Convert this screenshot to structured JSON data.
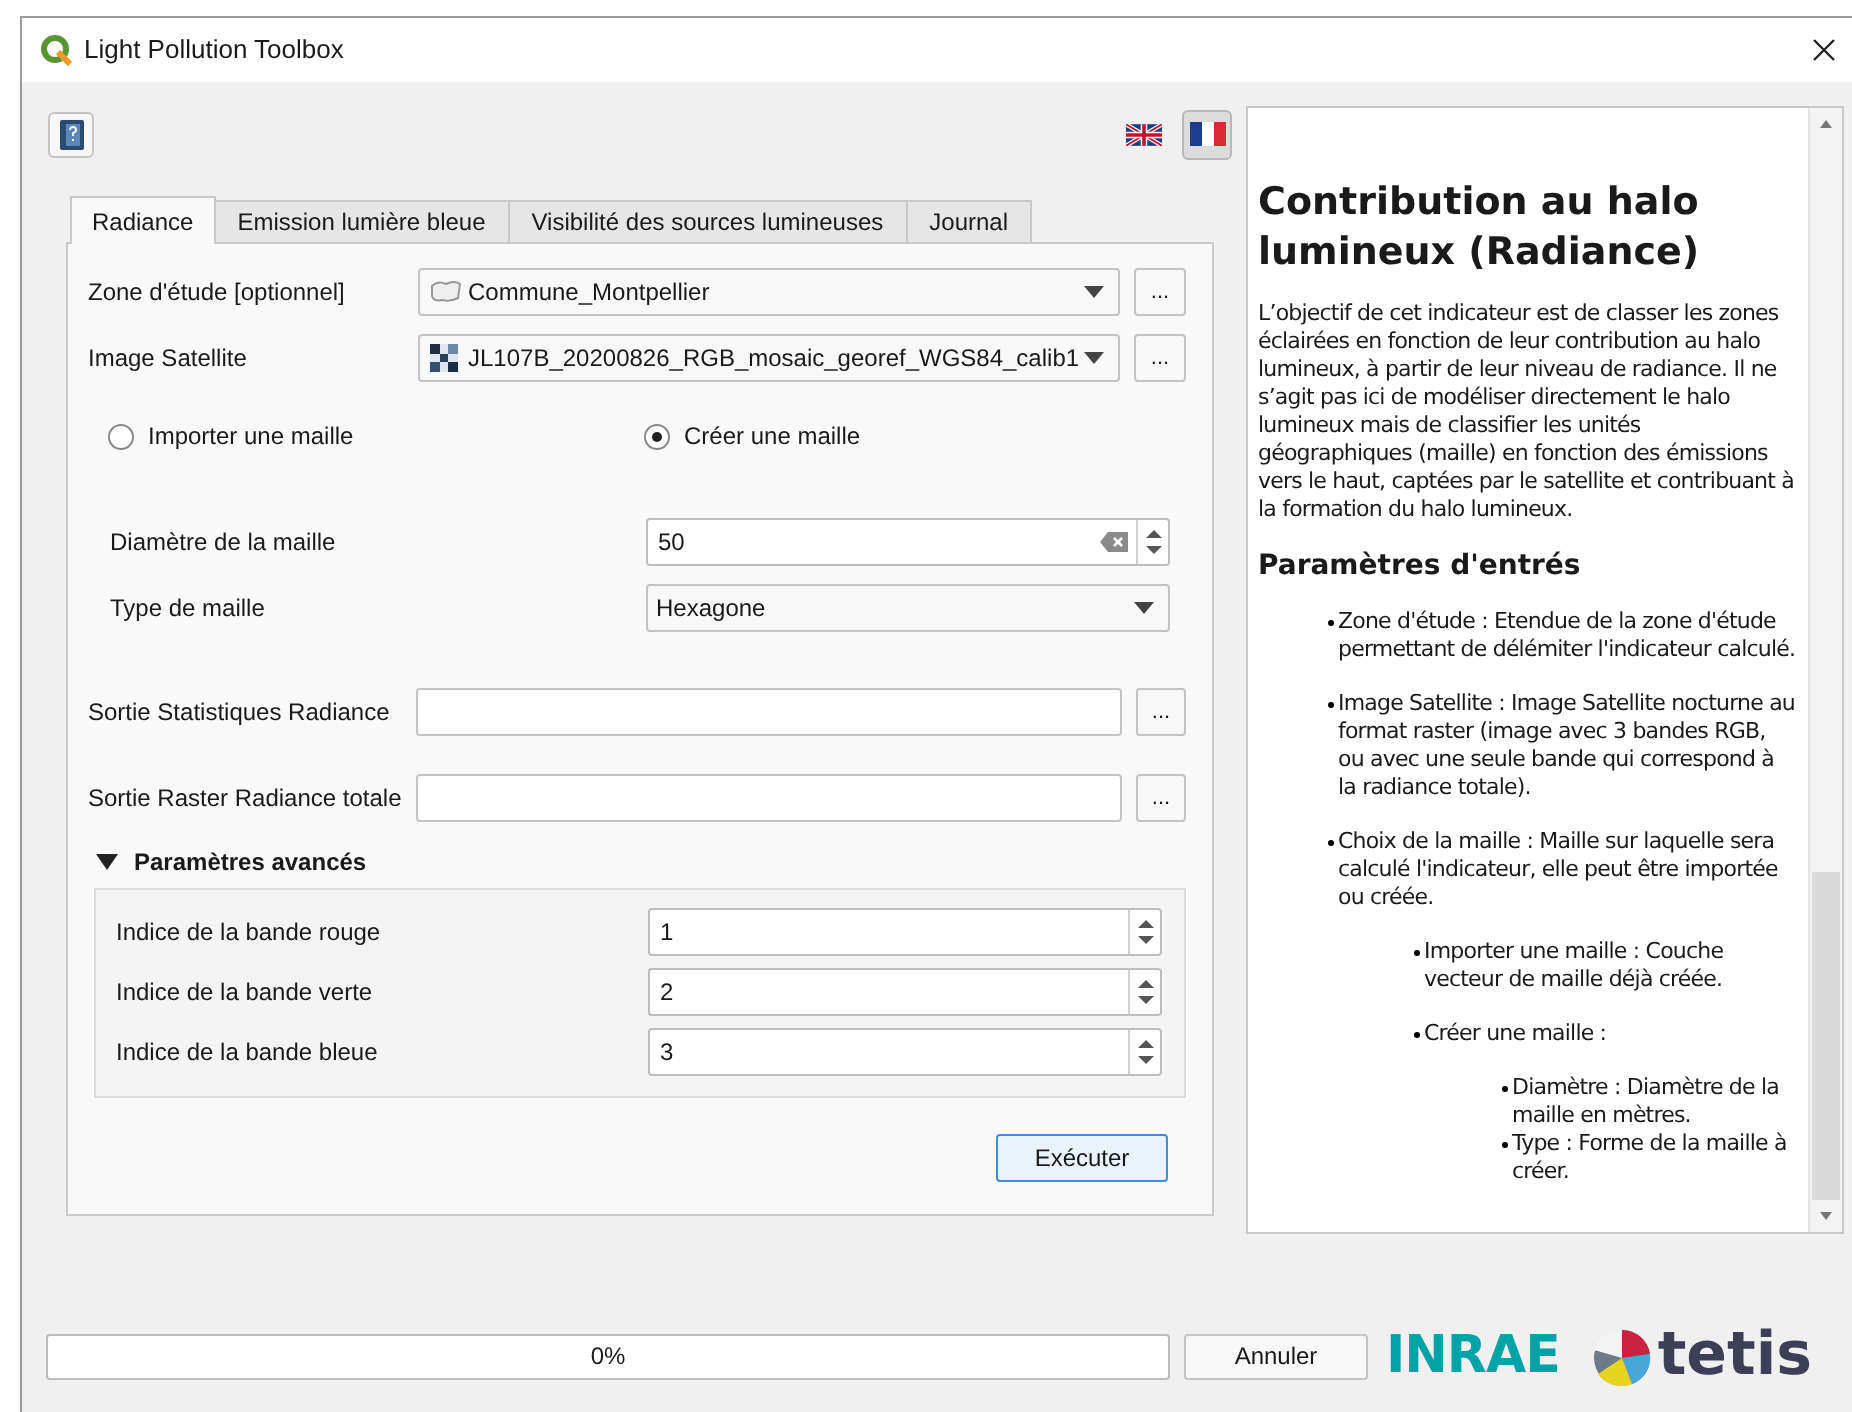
{
  "window": {
    "title": "Light Pollution Toolbox"
  },
  "languages": [
    {
      "kind": "english",
      "selected": false
    },
    {
      "kind": "french",
      "selected": true
    }
  ],
  "tabs": [
    {
      "label": "Radiance",
      "selected": true
    },
    {
      "label": "Emission lumière bleue",
      "selected": false
    },
    {
      "label": "Visibilité des sources lumineuses",
      "selected": false
    },
    {
      "label": "Journal",
      "selected": false
    }
  ],
  "layers": [
    {
      "label": "Zone d'étude [optionnel]",
      "kind": "vector",
      "value": "Commune_Montpellier",
      "button": "..."
    },
    {
      "label": "Image Satellite",
      "kind": "raster",
      "value": "JL107B_20200826_RGB_mosaic_georef_WGS84_calib1",
      "button": "..."
    }
  ],
  "mesh_options": [
    {
      "label": "Importer une maille",
      "selected": false
    },
    {
      "label": "Créer une maille",
      "selected": true
    }
  ],
  "diameter": {
    "label": "Diamètre de la maille",
    "value": "50"
  },
  "mesh_type": {
    "label": "Type de maille",
    "value": "Hexagone"
  },
  "outputs": [
    {
      "label": "Sortie Statistiques Radiance",
      "button": "..."
    },
    {
      "label": "Sortie Raster Radiance totale",
      "button": "..."
    }
  ],
  "advanced": {
    "label": "Paramètres avancés",
    "expanded": true,
    "fields": [
      {
        "label": "Indice de la bande rouge",
        "value": "1"
      },
      {
        "label": "Indice de la bande verte",
        "value": "2"
      },
      {
        "label": "Indice de la bande bleue",
        "value": "3"
      }
    ]
  },
  "run_button": "Exécuter",
  "help": {
    "title": "Contribution au halo lumineux (Radiance)",
    "intro": "L’objectif de cet indicateur est de classer les zones éclairées en fonction de leur contribution au halo lumineux, à partir de leur niveau de radiance. Il ne s’agit pas ici de modéliser directement le halo lumineux mais de classifier les unités géographiques (maille) en fonction des émissions vers le haut, captées par le satellite et contribuant à la formation du halo lumineux.",
    "subtitle": "Paramètres d'entrés",
    "items": [
      {
        "text": "Zone d'étude : Etendue de la zone d'étude permettant de délémiter l'indicateur calculé."
      },
      {
        "text": "Image Satellite : Image Satellite nocturne au format raster (image avec 3 bandes RGB, ou avec une seule bande qui correspond à la radiance totale)."
      },
      {
        "text": "Choix de la maille : Maille sur laquelle sera calculé l'indicateur, elle peut être importée ou créée.",
        "children": [
          {
            "text": "Importer une maille : Couche vecteur de maille déjà créée."
          },
          {
            "text": "Créer une maille :",
            "children": [
              {
                "text": "Diamètre : Diamètre de la maille en mètres."
              },
              {
                "text": "Type : Forme de la maille à créer."
              }
            ]
          }
        ]
      }
    ]
  },
  "progress": {
    "level": 0,
    "reading": "0%"
  },
  "cancel_button": "Annuler",
  "logos": {
    "inrae": "INRAE",
    "tetis": "tetis"
  }
}
